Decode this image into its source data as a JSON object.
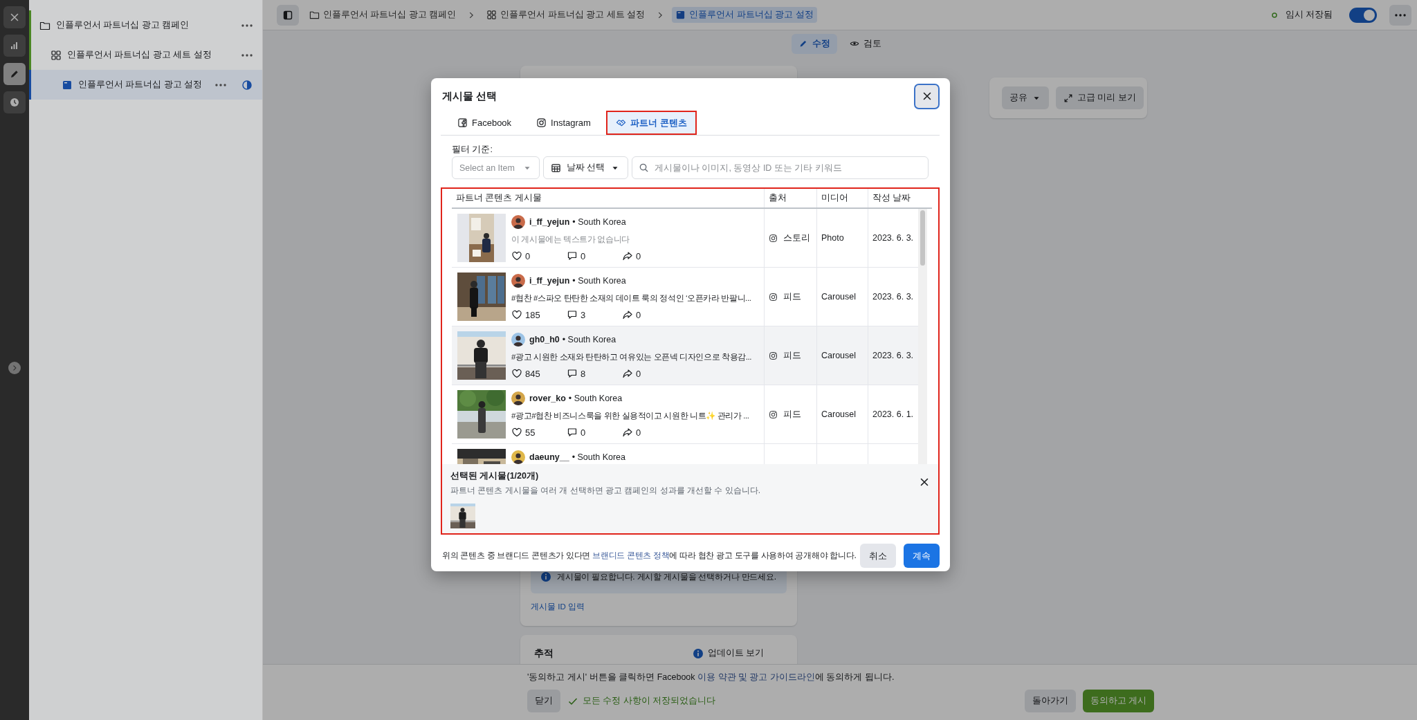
{
  "rail": [
    {
      "kind": "close",
      "selected": false
    },
    {
      "kind": "insights",
      "selected": false
    },
    {
      "kind": "edit",
      "selected": true
    },
    {
      "kind": "history",
      "selected": false
    }
  ],
  "tree": [
    {
      "label": "인플루언서 파트너십 광고 캠페인",
      "kind": "campaign",
      "selected": false,
      "children": [
        {
          "label": "인플루언서 파트너십 광고 세트 설정",
          "kind": "adset",
          "selected": false,
          "children": [
            {
              "label": "인플루언서 파트너십 광고 설정",
              "kind": "ad",
              "selected": true
            }
          ]
        }
      ]
    }
  ],
  "breadcrumbs": [
    {
      "label": "인플루언서 파트너십 광고 캠페인",
      "kind": "campaign",
      "selected": false
    },
    {
      "label": "인플루언서 파트너십 광고 세트 설정",
      "kind": "adset",
      "selected": false
    },
    {
      "label": "인플루언서 파트너십 광고 설정",
      "kind": "ad",
      "selected": true
    }
  ],
  "save_status": "임시 저장됨",
  "toggle": {
    "on": true
  },
  "mode_tabs": [
    {
      "label": "수정",
      "kind": "edit",
      "selected": true
    },
    {
      "label": "검토",
      "kind": "review",
      "selected": false
    }
  ],
  "preview_card": {
    "buttons": [
      {
        "label": "공유",
        "kind": "share"
      },
      {
        "label": "고급 미리 보기",
        "kind": "preview"
      }
    ]
  },
  "post_card": {
    "notice": "게시물이 필요합니다. 게시할 게시물을 선택하거나 만드세요.",
    "link": "게시물 ID 입력"
  },
  "tracking_card": {
    "title": "추적",
    "link": "업데이트 보기"
  },
  "footer": {
    "notice_before": "'동의하고 게시' 버튼을 클릭하면 Facebook ",
    "notice_link": "이용 약관 및 광고 가이드라인",
    "notice_after": "에 동의하게 됩니다.",
    "close_button": "닫기",
    "saved_status": "모든 수정 사항이 저장되었습니다",
    "back_button": "돌아가기",
    "publish_button": "동의하고 게시"
  },
  "modal": {
    "title": "게시물 선택",
    "tabs": [
      {
        "label": "Facebook",
        "kind": "facebook",
        "selected": false
      },
      {
        "label": "Instagram",
        "kind": "instagram",
        "selected": false
      },
      {
        "label": "파트너 콘텐츠",
        "kind": "partner",
        "selected": true
      }
    ],
    "filter_label": "필터 기준:",
    "filters": [
      {
        "kind": "select",
        "placeholder": "Select an Item"
      },
      {
        "kind": "date",
        "label": "날짜 선택"
      }
    ],
    "search": {
      "placeholder": "게시물이나 이미지, 동영상 ID 또는 기타 키워드"
    },
    "table": {
      "columns": [
        "파트너 콘텐츠 게시물",
        "출처",
        "미디어",
        "작성 날짜"
      ],
      "rows": [
        {
          "user": "i_ff_yejun",
          "location": "• South Korea",
          "caption": "이 게시물에는 텍스트가 없습니다",
          "caption_empty": true,
          "likes": "0",
          "comments": "0",
          "shares": "0",
          "source": "스토리",
          "media": "Photo",
          "date": "2023. 6. 3.",
          "selected": false
        },
        {
          "user": "i_ff_yejun",
          "location": "• South Korea",
          "caption": "#협찬 #스파오 탄탄한 소재의 데이트 룩의 정석인 ‘오픈카라 반팔니...",
          "caption_empty": false,
          "likes": "185",
          "comments": "3",
          "shares": "0",
          "source": "피드",
          "media": "Carousel",
          "date": "2023. 6. 3.",
          "selected": false
        },
        {
          "user": "gh0_h0",
          "location": "• South Korea",
          "caption": "#광고 시원한 소재와 탄탄하고 여유있는 오픈넥 디자인으로 착용감...",
          "caption_empty": false,
          "likes": "845",
          "comments": "8",
          "shares": "0",
          "source": "피드",
          "media": "Carousel",
          "date": "2023. 6. 3.",
          "selected": true
        },
        {
          "user": "rover_ko",
          "location": "• South Korea",
          "caption": "#광고#협찬 비즈니스룩을 위한 실용적이고 시원한 니트✨ 관리가 ...",
          "caption_empty": false,
          "likes": "55",
          "comments": "0",
          "shares": "0",
          "source": "피드",
          "media": "Carousel",
          "date": "2023. 6. 1.",
          "selected": false
        },
        {
          "user": "daeuny__",
          "location": "• South Korea",
          "selected": false
        }
      ]
    },
    "selection": {
      "title": "선택된 게시물(1/20개)",
      "description": "파트너 콘텐츠 게시물을 여러 개 선택하면 광고 캠페인의 성과를 개선할 수 있습니다."
    },
    "footer": {
      "text_before": "위의 콘텐츠 중 브랜디드 콘텐츠가 있다면 ",
      "link": "브랜디드 콘텐츠 정책",
      "text_after": "에 따라 협찬 광고 도구를 사용하여 공개해야 합니다."
    },
    "buttons": [
      {
        "label": "취소",
        "kind": "secondary"
      },
      {
        "label": "계속",
        "kind": "primary"
      }
    ]
  }
}
